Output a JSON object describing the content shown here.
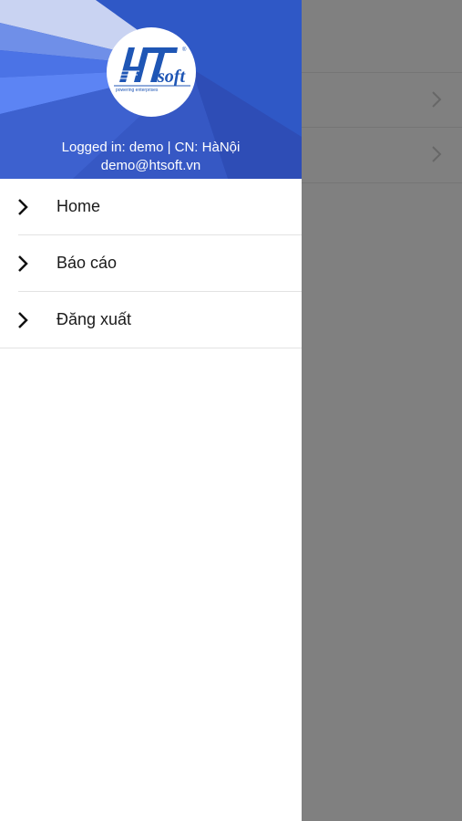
{
  "drawer": {
    "header": {
      "logo": {
        "brand_text": "HTsoft",
        "tagline": "powering enterprises"
      },
      "logged_in_text": "Logged in: demo | CN: HàNội",
      "email": "demo@htsoft.vn"
    },
    "menu": [
      {
        "label": "Home",
        "icon": "chevron-right-icon"
      },
      {
        "label": "Báo cáo",
        "icon": "chevron-right-icon"
      },
      {
        "label": "Đăng xuất",
        "icon": "chevron-right-icon"
      }
    ]
  },
  "background_page": {
    "rows": [
      {
        "icon": "chevron-right-icon"
      },
      {
        "icon": "chevron-right-icon"
      }
    ],
    "overlay_color": "#808080"
  },
  "colors": {
    "header_blue": "#3a5fcd",
    "logo_blue": "#1f56b5",
    "text_dark": "#1a1a1a"
  }
}
